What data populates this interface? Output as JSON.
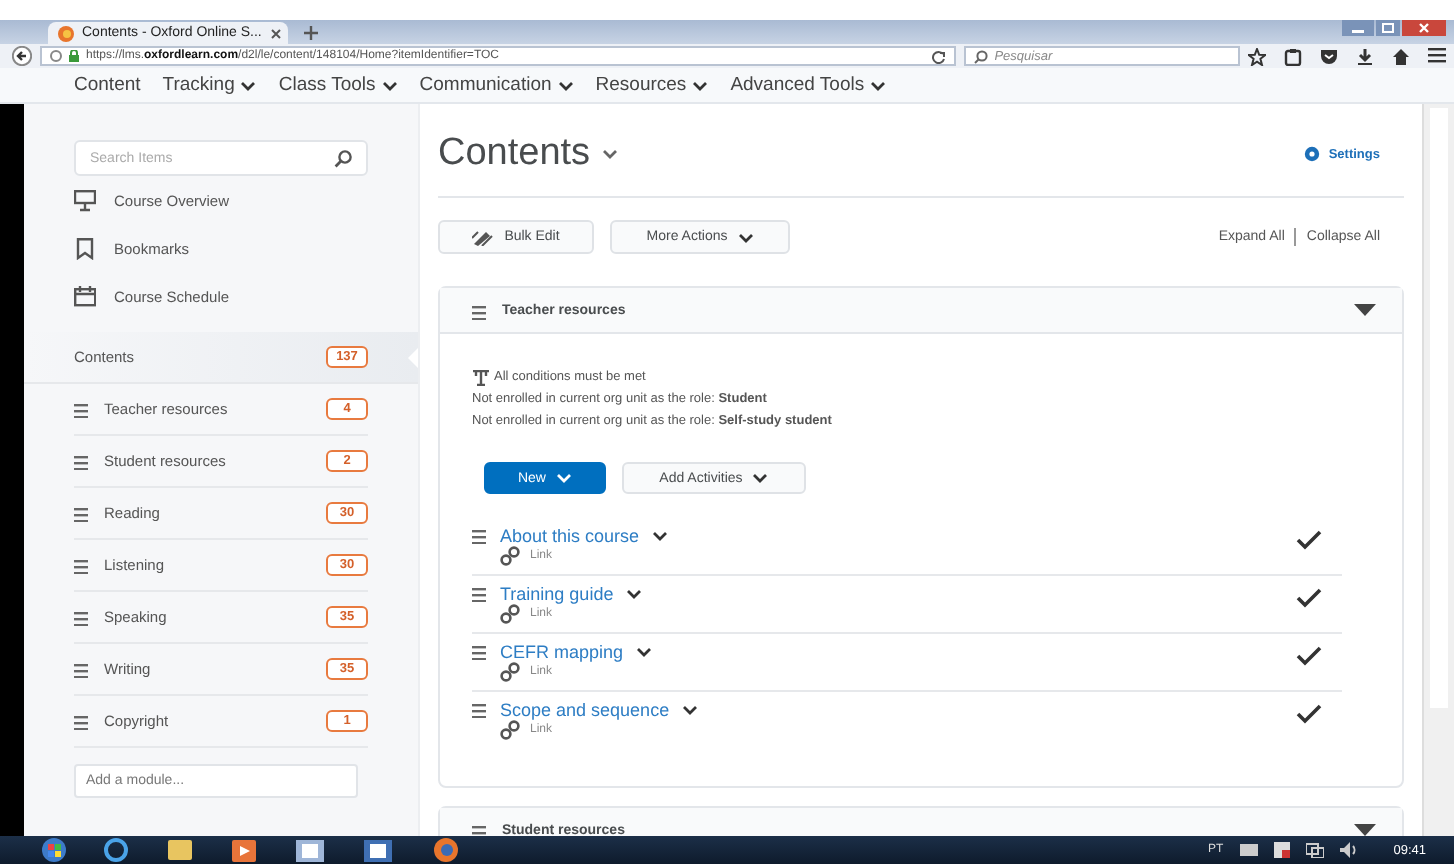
{
  "browser": {
    "tab_title": "Contents - Oxford Online S...",
    "url": "https://lms.**oxfordlearn.com**/d2l/le/content/148104/Home?itemIdentifier=TOC",
    "search_placeholder": "Pesquisar"
  },
  "nav": [
    {
      "label": "Content",
      "dropdown": false
    },
    {
      "label": "Tracking",
      "dropdown": true
    },
    {
      "label": "Class Tools",
      "dropdown": true
    },
    {
      "label": "Communication",
      "dropdown": true
    },
    {
      "label": "Resources",
      "dropdown": true
    },
    {
      "label": "Advanced Tools",
      "dropdown": true
    }
  ],
  "sidebar": {
    "search_placeholder": "Search Items",
    "links": [
      {
        "label": "Course Overview",
        "kind": "overview"
      },
      {
        "label": "Bookmarks",
        "kind": "bookmark"
      },
      {
        "label": "Course Schedule",
        "kind": "calendar"
      }
    ],
    "contents": {
      "label": "Contents",
      "count": "137",
      "selected": true
    },
    "modules": [
      {
        "label": "Teacher resources",
        "count": "4",
        "selected": false
      },
      {
        "label": "Student resources",
        "count": "2",
        "selected": false
      },
      {
        "label": "Reading",
        "count": "30",
        "selected": false
      },
      {
        "label": "Listening",
        "count": "30",
        "selected": false
      },
      {
        "label": "Speaking",
        "count": "35",
        "selected": false
      },
      {
        "label": "Writing",
        "count": "35",
        "selected": false
      },
      {
        "label": "Copyright",
        "count": "1",
        "selected": false
      }
    ],
    "add_module_placeholder": "Add a module..."
  },
  "main": {
    "title": "Contents",
    "settings": "Settings",
    "bulk_edit": "Bulk Edit",
    "more_actions": "More Actions",
    "expand_all": "Expand All",
    "collapse_all": "Collapse All",
    "modules": [
      {
        "title": "Teacher resources",
        "expanded": true,
        "conditions": {
          "heading": "All conditions must be met",
          "lines": [
            "Not enrolled in current org unit as the role: **Student**",
            "Not enrolled in current org unit as the role: **Self-study student**"
          ]
        },
        "buttons": {
          "new": "New",
          "add_activities": "Add Activities"
        },
        "items": [
          {
            "title": "About this course",
            "type": "Link",
            "completed": true
          },
          {
            "title": "Training guide",
            "type": "Link",
            "completed": true
          },
          {
            "title": "CEFR mapping",
            "type": "Link",
            "completed": true
          },
          {
            "title": "Scope and sequence",
            "type": "Link",
            "completed": true
          }
        ]
      },
      {
        "title": "Student resources",
        "expanded": true
      }
    ]
  },
  "taskbar": {
    "language": "PT",
    "time": "09:41"
  }
}
